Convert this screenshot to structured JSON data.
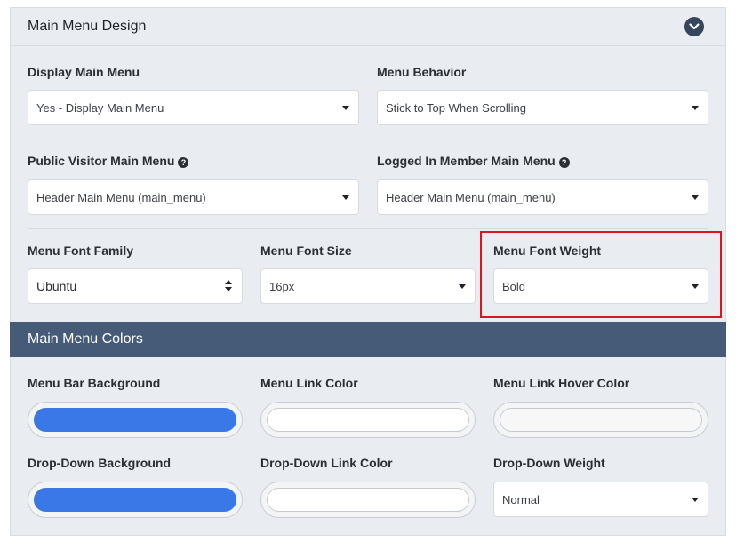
{
  "section": {
    "title": "Main Menu Design"
  },
  "fields": {
    "display_main_menu": {
      "label": "Display Main Menu",
      "value": "Yes - Display Main Menu"
    },
    "menu_behavior": {
      "label": "Menu Behavior",
      "value": "Stick to Top When Scrolling"
    },
    "public_visitor_main_menu": {
      "label": "Public Visitor Main Menu",
      "value": "Header Main Menu (main_menu)",
      "help_icon": "question-circle"
    },
    "logged_in_member_main_menu": {
      "label": "Logged In Member Main Menu",
      "value": "Header Main Menu (main_menu)",
      "help_icon": "question-circle"
    },
    "menu_font_family": {
      "label": "Menu Font Family",
      "value": "Ubuntu"
    },
    "menu_font_size": {
      "label": "Menu Font Size",
      "value": "16px"
    },
    "menu_font_weight": {
      "label": "Menu Font Weight",
      "value": "Bold"
    }
  },
  "colors_section": {
    "title": "Main Menu Colors",
    "bar_color": "#455b78",
    "menu_bar_background": {
      "label": "Menu Bar Background",
      "color": "#3b78e7"
    },
    "menu_link_color": {
      "label": "Menu Link Color",
      "color": "#ffffff"
    },
    "menu_link_hover_color": {
      "label": "Menu Link Hover Color",
      "color": "#f7f7f7"
    },
    "dropdown_background": {
      "label": "Drop-Down Background",
      "color": "#3b78e7"
    },
    "dropdown_link_color": {
      "label": "Drop-Down Link Color",
      "color": "#ffffff"
    },
    "dropdown_weight": {
      "label": "Drop-Down Weight",
      "value": "Normal"
    }
  },
  "highlight_color": "#e0141b"
}
